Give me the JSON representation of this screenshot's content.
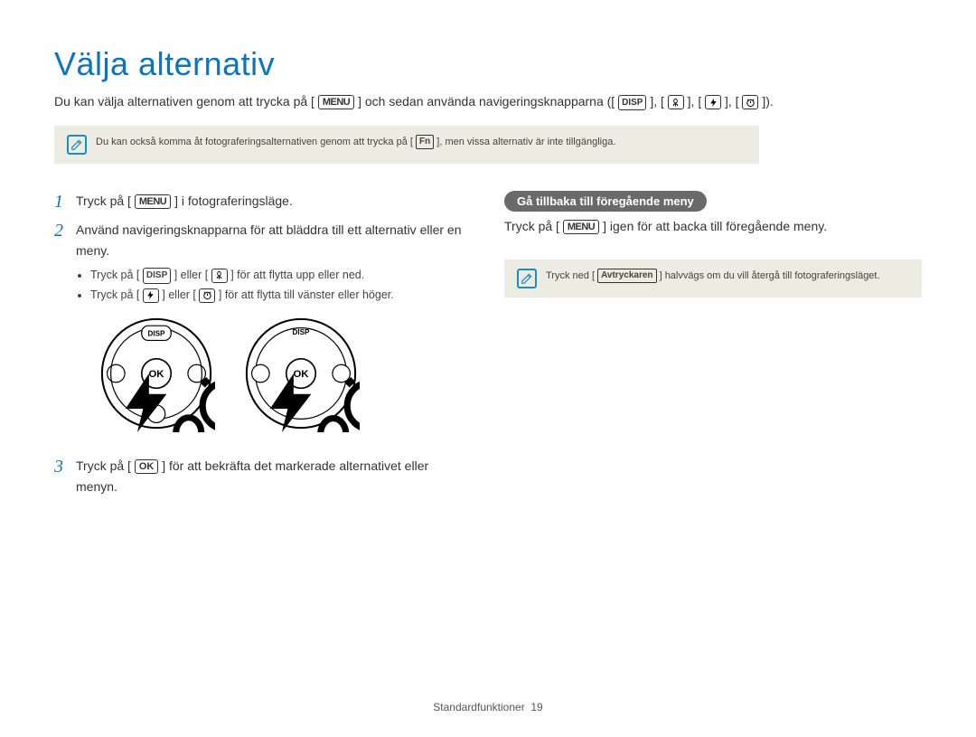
{
  "heading": "Välja alternativ",
  "intro_parts": {
    "p1": "Du kan välja alternativen genom att trycka på [",
    "p2": "] och sedan använda navigeringsknapparna ([",
    "p3": "], [",
    "p4": "], [",
    "p5": "], [",
    "p6": "]).",
    "menu": "MENU",
    "disp": "DISP"
  },
  "top_note": {
    "t1": "Du kan också komma åt fotograferingsalternativen genom att trycka på [",
    "fn": "Fn",
    "t2": "], men vissa alternativ är inte tillgängliga."
  },
  "steps": {
    "s1a": "Tryck på [",
    "s1b": "] i fotograferingsläge.",
    "s2": "Använd navigeringsknapparna för att bläddra till ett alternativ eller en meny.",
    "sub1a": "Tryck på [",
    "sub1b": "] eller [",
    "sub1c": "] för att flytta upp eller ned.",
    "sub2a": "Tryck på [",
    "sub2b": "] eller [",
    "sub2c": "] för att flytta till vänster eller höger.",
    "s3a": "Tryck på [",
    "s3b": "] för att bekräfta det markerade alternativet eller menyn.",
    "menu": "MENU",
    "disp": "DISP",
    "ok": "OK"
  },
  "right": {
    "pill": "Gå tillbaka till föregående meny",
    "line_a": "Tryck på [",
    "menu": "MENU",
    "line_b": "] igen för att backa till föregående meny.",
    "note_a": "Tryck ned [",
    "shutter": "Avtryckaren",
    "note_b": "] halvvägs om du vill återgå till fotograferingsläget."
  },
  "footer": {
    "label": "Standardfunktioner",
    "page": "19"
  },
  "dial": {
    "disp": "DISP",
    "ok": "OK"
  }
}
